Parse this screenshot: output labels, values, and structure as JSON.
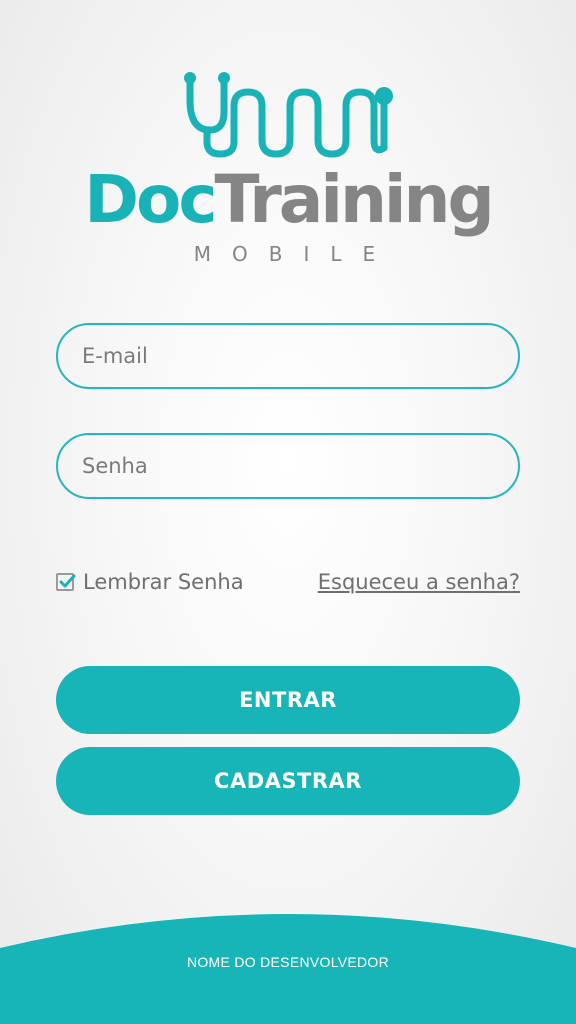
{
  "logo": {
    "brand_part1": "Doc",
    "brand_part2": "Training",
    "subtitle": "MOBILE",
    "icon": "stethoscope-icon"
  },
  "login_form": {
    "email_placeholder": "E-mail",
    "email_value": "",
    "password_placeholder": "Senha",
    "password_value": "",
    "remember_label": "Lembrar Senha",
    "remember_checked": true,
    "forgot_link": "Esqueceu a senha?"
  },
  "actions": {
    "enter_label": "ENTRAR",
    "register_label": "CADASTRAR"
  },
  "footer": {
    "developer_text": "NOME DO DESENVOLVEDOR"
  },
  "colors": {
    "accent": "#17b4b8",
    "brand_gray": "#858585",
    "text_gray": "#6f6f6f",
    "background": "#f4f4f4"
  }
}
